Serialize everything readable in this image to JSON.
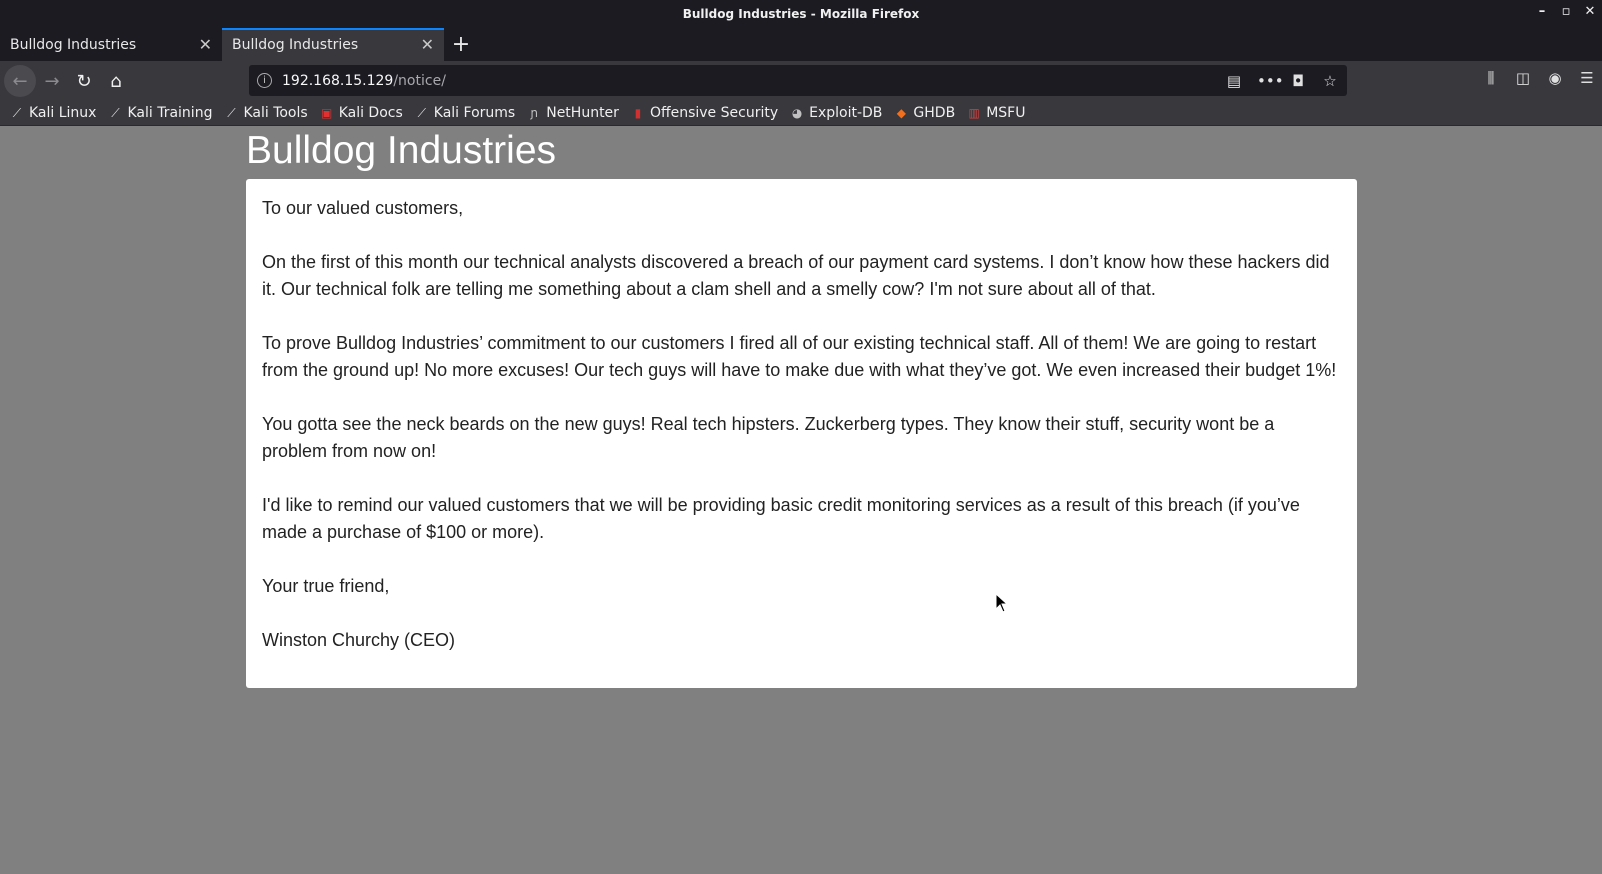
{
  "window": {
    "title": "Bulldog Industries - Mozilla Firefox",
    "controls": {
      "minimize": "–",
      "maximize": "▫",
      "close": "✕"
    }
  },
  "tabs": [
    {
      "label": "Bulldog Industries",
      "close": "✕",
      "active": false
    },
    {
      "label": "Bulldog Industries",
      "close": "✕",
      "active": true
    }
  ],
  "new_tab_icon": "+",
  "nav": {
    "back_icon": "←",
    "forward_icon": "→",
    "reload_icon": "↻",
    "home_icon": "⌂"
  },
  "urlbar": {
    "info_icon": "i",
    "host": "192.168.15.129",
    "path": "/notice/",
    "reader_icon": "▤",
    "more_icon": "•••",
    "pocket_icon": "◘",
    "star_icon": "☆"
  },
  "toolbar_right": {
    "library_icon": "⫼",
    "sidebar_icon": "◫",
    "account_icon": "◉",
    "menu_icon": "☰"
  },
  "bookmarks": [
    {
      "label": "Kali Linux",
      "icon": "dragon-icon",
      "glyph": "⟋",
      "color": "#e0e0e0"
    },
    {
      "label": "Kali Training",
      "icon": "dragon-icon",
      "glyph": "⟋",
      "color": "#e0e0e0"
    },
    {
      "label": "Kali Tools",
      "icon": "dragon-icon",
      "glyph": "⟋",
      "color": "#e0e0e0"
    },
    {
      "label": "Kali Docs",
      "icon": "docs-icon",
      "glyph": "▣",
      "color": "#e03030"
    },
    {
      "label": "Kali Forums",
      "icon": "dragon-icon",
      "glyph": "⟋",
      "color": "#e0e0e0"
    },
    {
      "label": "NetHunter",
      "icon": "nethunter-icon",
      "glyph": "ɲ",
      "color": "#c0c0c0"
    },
    {
      "label": "Offensive Security",
      "icon": "offsec-icon",
      "glyph": "▮",
      "color": "#d03030"
    },
    {
      "label": "Exploit-DB",
      "icon": "exploitdb-icon",
      "glyph": "◕",
      "color": "#c0c0c0"
    },
    {
      "label": "GHDB",
      "icon": "ghdb-icon",
      "glyph": "◆",
      "color": "#f07020"
    },
    {
      "label": "MSFU",
      "icon": "msfu-icon",
      "glyph": "▥",
      "color": "#d04040"
    }
  ],
  "page": {
    "title": "Bulldog Industries",
    "paragraphs": [
      "To our valued customers,",
      "On the first of this month our technical analysts discovered a breach of our payment card systems. I don’t know how these hackers did it. Our technical folk are telling me something about a clam shell and a smelly cow? I'm not sure about all of that.",
      "To prove Bulldog Industries’ commitment to our customers I fired all of our existing technical staff. All of them! We are going to restart from the ground up! No more excuses! Our tech guys will have to make due with what they’ve got. We even increased their budget 1%!",
      "You gotta see the neck beards on the new guys! Real tech hipsters. Zuckerberg types. They know their stuff, security wont be a problem from now on!",
      "I'd like to remind our valued customers that we will be providing basic credit monitoring services as a result of this breach (if you’ve made a purchase of $100 or more).",
      "Your true friend,",
      "Winston Churchy (CEO)"
    ]
  }
}
